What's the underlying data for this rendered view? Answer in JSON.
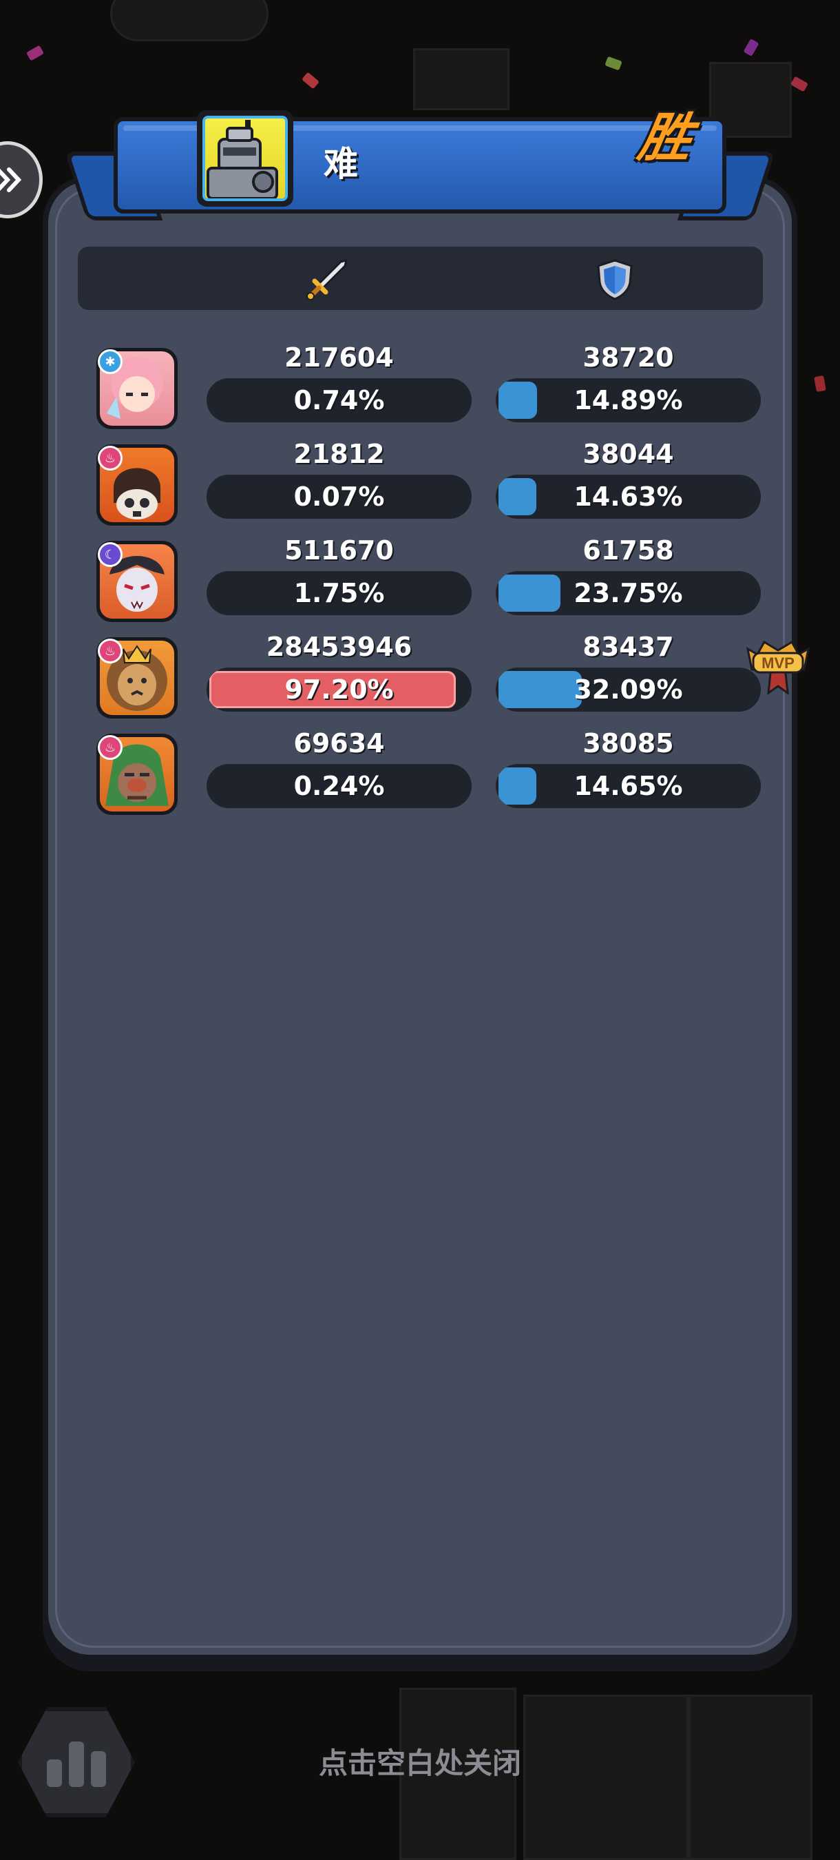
{
  "header": {
    "difficulty_label": "难",
    "result_label": "胜"
  },
  "columns": {
    "damage_icon": "sword-icon",
    "defense_icon": "shield-icon"
  },
  "rows": [
    {
      "hero": "pink-hair-ice-hero",
      "element": "ice",
      "damage": "217604",
      "damage_pct": "0.74%",
      "damage_frac": 0.0074,
      "defense": "38720",
      "defense_pct": "14.89%",
      "defense_frac": 0.1489
    },
    {
      "hero": "skull-mask-fire-hero",
      "element": "fire",
      "damage": "21812",
      "damage_pct": "0.07%",
      "damage_frac": 0.0007,
      "defense": "38044",
      "defense_pct": "14.63%",
      "defense_frac": 0.1463
    },
    {
      "hero": "vampire-hero",
      "element": "moon",
      "damage": "511670",
      "damage_pct": "1.75%",
      "damage_frac": 0.0175,
      "defense": "61758",
      "defense_pct": "23.75%",
      "defense_frac": 0.2375
    },
    {
      "hero": "lion-king-hero",
      "element": "fire",
      "damage": "28453946",
      "damage_pct": "97.20%",
      "damage_frac": 0.972,
      "defense": "83437",
      "defense_pct": "32.09%",
      "defense_frac": 0.3209,
      "mvp": true
    },
    {
      "hero": "hooded-goblin-hero",
      "element": "fire",
      "damage": "69634",
      "damage_pct": "0.24%",
      "damage_frac": 0.0024,
      "defense": "38085",
      "defense_pct": "14.65%",
      "defense_frac": 0.1465
    }
  ],
  "mvp_label": "MVP",
  "footer": {
    "close_hint": "点击空白处关闭",
    "stats_icon": "bar-chart-icon"
  },
  "colors": {
    "panel": "#434b5c",
    "ribbon": "#2f69c4",
    "damage_fill": "#e35f63",
    "defense_fill": "#3b93d4",
    "victory": "#ff9e1f"
  }
}
